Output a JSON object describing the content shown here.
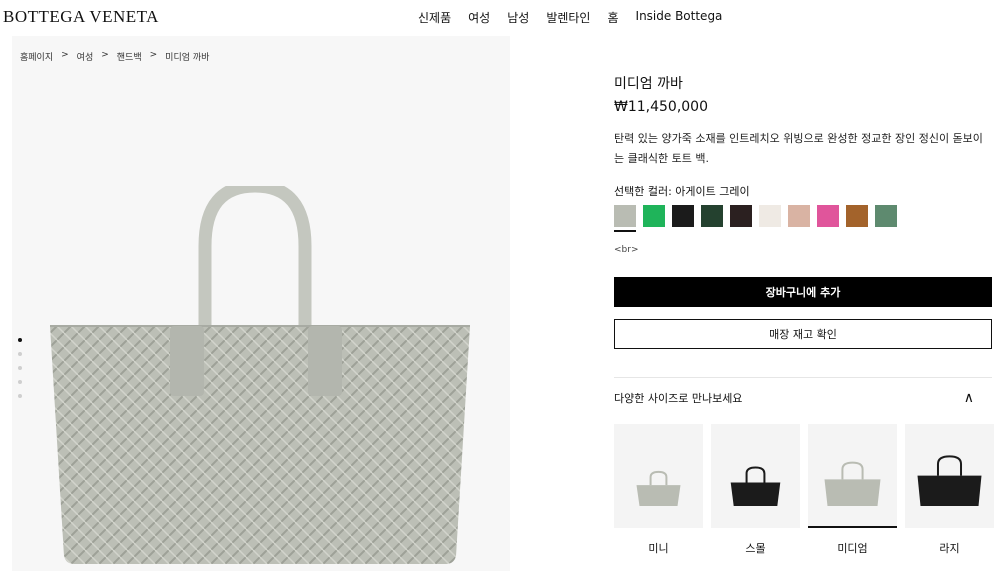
{
  "header": {
    "logo": "BOTTEGA VENETA",
    "nav": [
      "신제품",
      "여성",
      "남성",
      "발렌타인",
      "홈",
      "Inside Bottega"
    ]
  },
  "breadcrumb": [
    "홈페이지",
    ">",
    "여성",
    ">",
    "핸드백",
    ">",
    "미디엄 까바"
  ],
  "product": {
    "name": "미디엄 까바",
    "price": "₩11,450,000",
    "description": "탄력 있는 양가죽 소재를 인트레치오 위빙으로 완성한 정교한 장인 정신이 돋보이는 클래식한 토트 백.",
    "color_label": "선택한 컬러: 아게이트 그레이",
    "swatch_colors": [
      "#b9bcb3",
      "#1fb45a",
      "#1b1b1b",
      "#24412f",
      "#2b2020",
      "#efeae4",
      "#d9b3a3",
      "#e0559b",
      "#a3632b",
      "#5e8a6f"
    ],
    "br_text": "<br>",
    "add_to_bag": "장바구니에 추가",
    "check_store": "매장 재고 확인"
  },
  "sizes": {
    "heading": "다양한 사이즈로 만나보세요",
    "items": [
      {
        "label": "미니",
        "color": "#b9bcb3"
      },
      {
        "label": "스몰",
        "color": "#1b1b1b"
      },
      {
        "label": "미디엄",
        "color": "#b9bcb3"
      },
      {
        "label": "라지",
        "color": "#1b1b1b"
      }
    ]
  }
}
